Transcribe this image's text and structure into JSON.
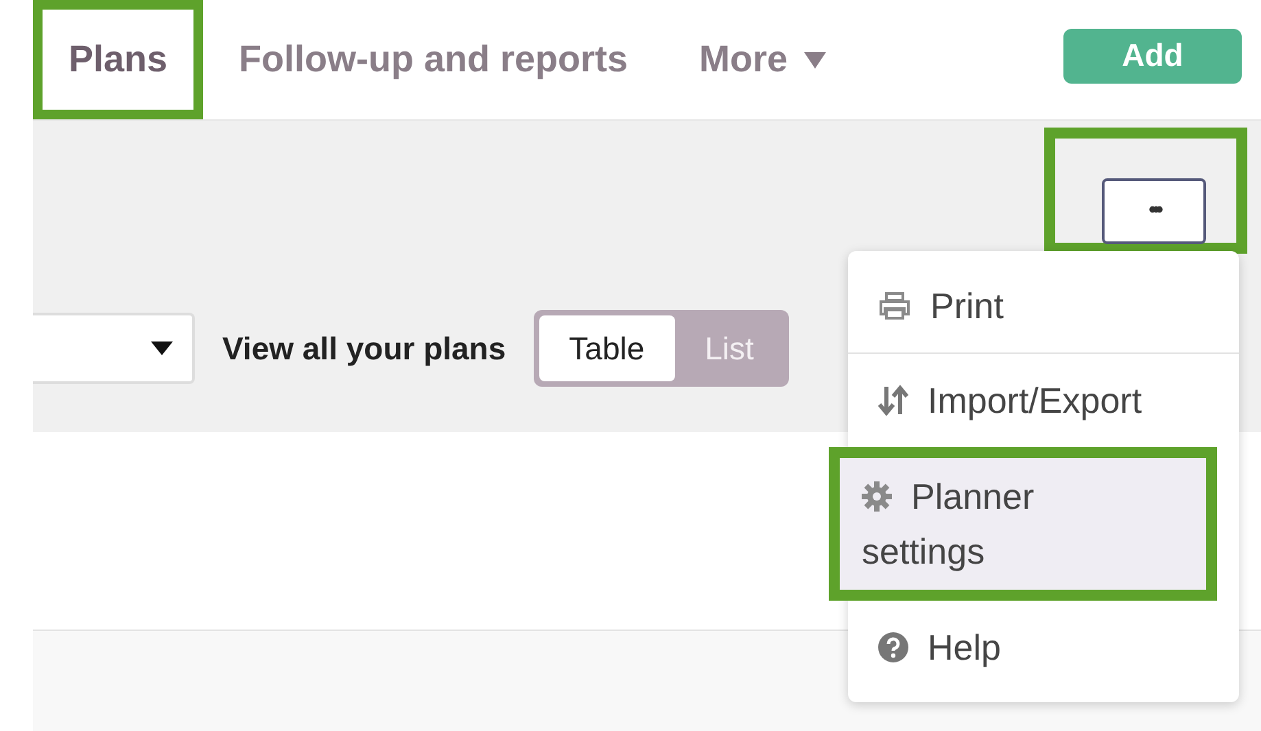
{
  "tabs": [
    {
      "label": "Plans",
      "selected": true,
      "highlighted": true
    },
    {
      "label": "Follow-up and reports",
      "selected": false,
      "highlighted": false
    },
    {
      "label": "More",
      "selected": false,
      "highlighted": false
    }
  ],
  "add_button": {
    "label": "Add"
  },
  "more_button": {
    "label": "•••",
    "highlighted": true
  },
  "filter": {
    "label": "View all your plans"
  },
  "view_toggle": [
    {
      "label": "Table",
      "selected": true
    },
    {
      "label": "List",
      "selected": false
    }
  ],
  "menu": {
    "items": [
      {
        "label": "Print",
        "kind": "print",
        "highlighted": false
      },
      {
        "label": "Import/Export",
        "kind": "import-export",
        "highlighted": false
      },
      {
        "label": "Planner settings",
        "kind": "settings",
        "highlighted": true
      },
      {
        "label": "Help",
        "kind": "help",
        "highlighted": false
      }
    ]
  }
}
